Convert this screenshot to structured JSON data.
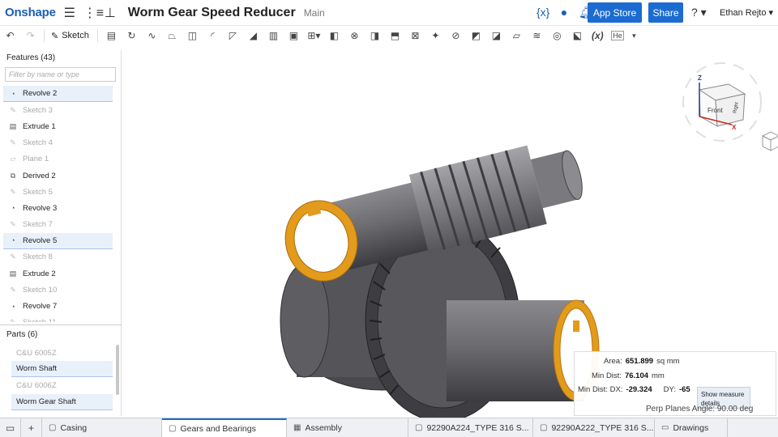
{
  "app": {
    "logo": "Onshape",
    "title": "Worm Gear Speed Reducer",
    "branch": "Main",
    "user": "Ethan Rejto ▾",
    "app_store": "App Store",
    "share": "Share",
    "help": "? ▾"
  },
  "toolbar": {
    "undo_icon": "undo-icon",
    "redo_icon": "redo-icon",
    "sketch_label": "Sketch",
    "extra_label": "He"
  },
  "features": {
    "title": "Features (43)",
    "filter_placeholder": "Filter by name or type",
    "items": [
      {
        "label": "Revolve 2",
        "icon": "revolve-icon",
        "state": "sel"
      },
      {
        "label": "Sketch 3",
        "icon": "sketch-icon",
        "state": "dim"
      },
      {
        "label": "Extrude 1",
        "icon": "extrude-icon",
        "state": ""
      },
      {
        "label": "Sketch 4",
        "icon": "sketch-icon",
        "state": "dim"
      },
      {
        "label": "Plane 1",
        "icon": "plane-icon",
        "state": "dim"
      },
      {
        "label": "Derived 2",
        "icon": "derived-icon",
        "state": ""
      },
      {
        "label": "Sketch 5",
        "icon": "sketch-icon",
        "state": "dim"
      },
      {
        "label": "Revolve 3",
        "icon": "revolve-icon",
        "state": ""
      },
      {
        "label": "Sketch 7",
        "icon": "sketch-icon",
        "state": "dim"
      },
      {
        "label": "Revolve 5",
        "icon": "revolve-icon",
        "state": "sel"
      },
      {
        "label": "Sketch 8",
        "icon": "sketch-icon",
        "state": "dim"
      },
      {
        "label": "Extrude 2",
        "icon": "extrude-icon",
        "state": ""
      },
      {
        "label": "Sketch 10",
        "icon": "sketch-icon",
        "state": "dim"
      },
      {
        "label": "Revolve 7",
        "icon": "revolve-icon",
        "state": ""
      },
      {
        "label": "Sketch 11",
        "icon": "sketch-icon",
        "state": "dim"
      }
    ]
  },
  "parts": {
    "title": "Parts (6)",
    "items": [
      {
        "label": "C&U 6005Z",
        "state": "dim"
      },
      {
        "label": "Worm Shaft",
        "state": "sel"
      },
      {
        "label": "C&U 6006Z",
        "state": "dim"
      },
      {
        "label": "Worm Gear Shaft",
        "state": "sel"
      }
    ]
  },
  "viewcube": {
    "face_front": "Front",
    "face_right": "Right",
    "axis_z": "Z",
    "axis_x": "X"
  },
  "measure": {
    "area_label": "Area:",
    "area_value": "651.899",
    "area_unit": "sq mm",
    "min_dist_label": "Min Dist:",
    "min_dist_value": "76.104",
    "min_dist_unit": "mm",
    "dx_label": "Min Dist: DX:",
    "dx_value": "-29.324",
    "dy_label": "DY:",
    "dy_value": "-65",
    "show_details": "Show measure details",
    "perp_angle": "Perp Planes Angle: 90.00 deg"
  },
  "tabs": [
    {
      "label": "Casing",
      "icon": "part-studio-icon",
      "active": false
    },
    {
      "label": "Gears and Bearings",
      "icon": "part-studio-icon",
      "active": true
    },
    {
      "label": "Assembly",
      "icon": "assembly-icon",
      "active": false
    },
    {
      "label": "92290A224_TYPE 316 S...",
      "icon": "part-studio-icon",
      "active": false
    },
    {
      "label": "92290A222_TYPE 316 S...",
      "icon": "part-studio-icon",
      "active": false
    },
    {
      "label": "Drawings",
      "icon": "drawing-icon",
      "active": false
    }
  ],
  "colors": {
    "brand": "#1b5fb5",
    "button": "#1b6bd1",
    "highlight": "#e39b1c",
    "model": "#6e6e72"
  }
}
